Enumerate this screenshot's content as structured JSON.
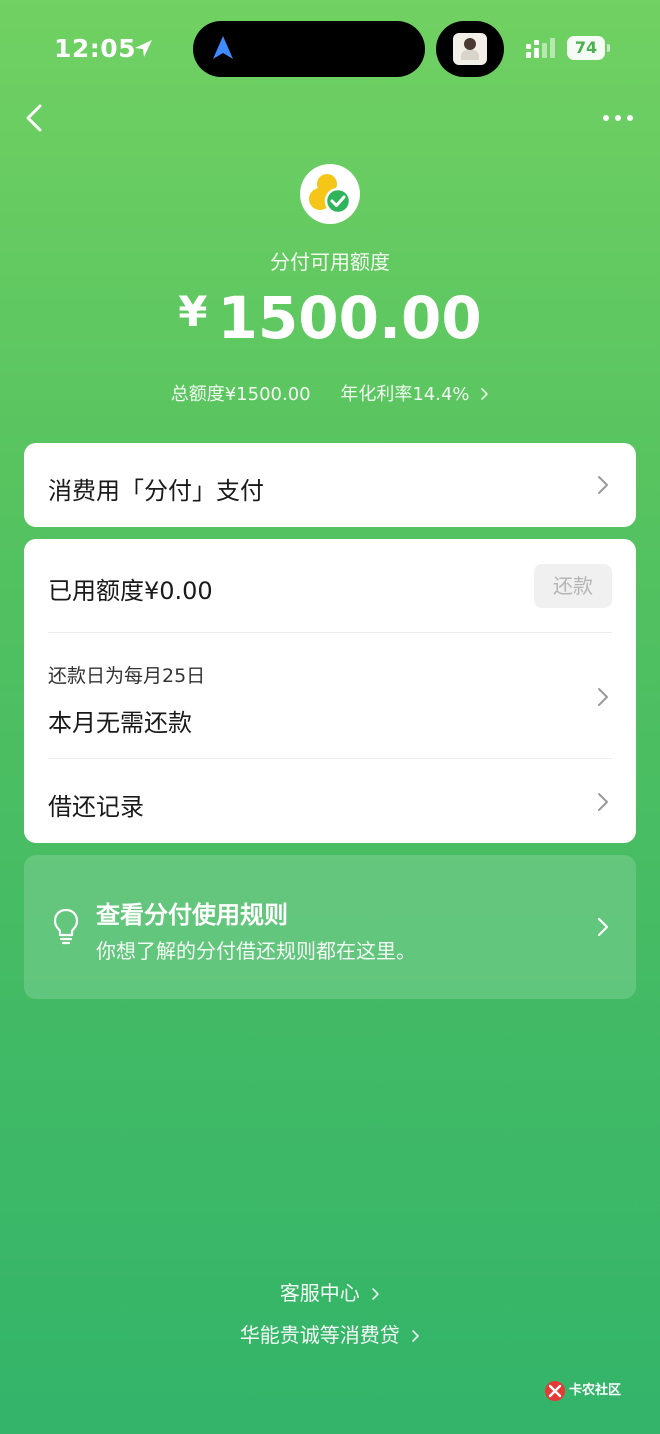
{
  "status_bar": {
    "time": "12:05",
    "battery": "74"
  },
  "header": {
    "back_icon": "chevron-left-icon",
    "more_icon": "ellipsis-icon"
  },
  "summary": {
    "logo_icon": "fenfu-logo-icon",
    "label": "分付可用额度",
    "currency": "¥",
    "available": "1500.00",
    "total_limit": "总额度¥1500.00",
    "annual_rate": "年化利率14.4%"
  },
  "pay_card": {
    "label": "消费用「分付」支付"
  },
  "usage_card": {
    "used_label": "已用额度¥0.00",
    "repay_button": "还款",
    "due_date": "还款日为每月25日",
    "due_status": "本月无需还款",
    "records_label": "借还记录"
  },
  "rules_card": {
    "icon": "lightbulb-icon",
    "title": "查看分付使用规则",
    "subtitle": "你想了解的分付借还规则都在这里。"
  },
  "footer": {
    "service_center": "客服中心",
    "loan_products": "华能贵诚等消费贷"
  },
  "watermark": {
    "text": "卡农社区"
  },
  "colors": {
    "gradient_top": "#71d162",
    "gradient_bottom": "#33b46a",
    "logo_yellow": "#f5c518",
    "logo_green": "#2fb45c"
  }
}
